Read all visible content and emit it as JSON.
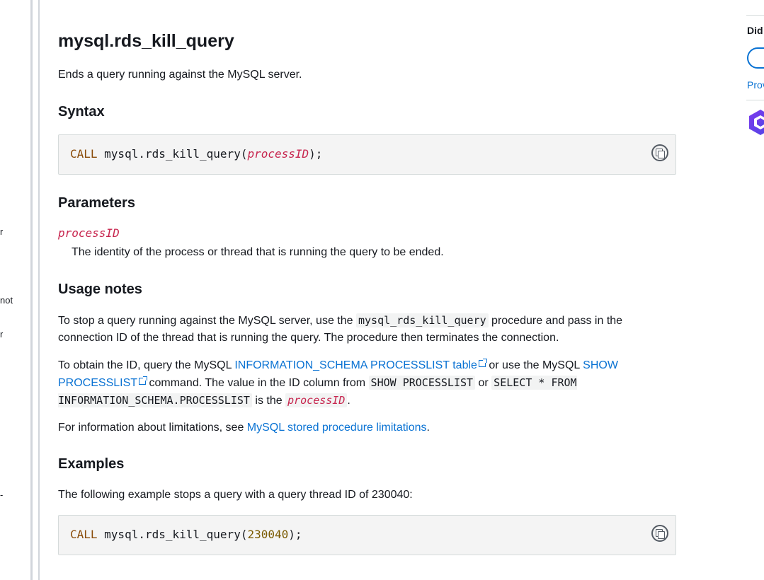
{
  "left_nav": {
    "fragments": [
      "r",
      "not",
      "r",
      "-"
    ]
  },
  "doc": {
    "title": "mysql.rds_kill_query",
    "lead": "Ends a query running against the MySQL server.",
    "syntax_heading": "Syntax",
    "syntax_code": {
      "keyword": "CALL",
      "fn": " mysql.rds_kill_query(",
      "arg": "processID",
      "end": ");"
    },
    "parameters_heading": "Parameters",
    "param_name": "processID",
    "param_desc": "The identity of the process or thread that is running the query to be ended.",
    "usage_heading": "Usage notes",
    "usage_p1": {
      "pre": "To stop a query running against the MySQL server, use the ",
      "code": "mysql_rds_kill_query",
      "post": " procedure and pass in the connection ID of the thread that is running the query. The procedure then terminates the connection."
    },
    "usage_p2": {
      "t1": "To obtain the ID, query the MySQL ",
      "link1": "INFORMATION_SCHEMA PROCESSLIST table",
      "t2": " or use the MySQL ",
      "link2": "SHOW PROCESSLIST",
      "t3": " command. The value in the ID column from ",
      "code1": "SHOW PROCESSLIST",
      "t4": " or ",
      "code2": "SELECT * FROM INFORMATION_SCHEMA.PROCESSLIST",
      "t5": " is the ",
      "var": "processID",
      "t6": "."
    },
    "usage_p3": {
      "pre": "For information about limitations, see ",
      "link": "MySQL stored procedure limitations",
      "post": "."
    },
    "examples_heading": "Examples",
    "examples_text": "The following example stops a query with a query thread ID of 230040:",
    "example_code": {
      "keyword": "CALL",
      "fn": " mysql.rds_kill_query(",
      "num": "230040",
      "end": ");"
    }
  },
  "right_rail": {
    "title": "Did",
    "link": "Prov"
  }
}
